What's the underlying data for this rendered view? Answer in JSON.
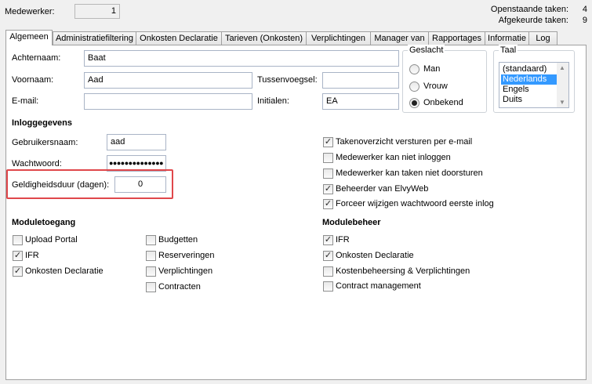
{
  "header": {
    "medewerker_label": "Medewerker:",
    "medewerker_value": "1",
    "openstaande_label": "Openstaande taken:",
    "openstaande_value": "4",
    "afgekeurde_label": "Afgekeurde taken:",
    "afgekeurde_value": "9"
  },
  "tabs": [
    {
      "label": "Algemeen",
      "active": true
    },
    {
      "label": "Administratiefiltering"
    },
    {
      "label": "Onkosten Declaratie"
    },
    {
      "label": "Tarieven (Onkosten)"
    },
    {
      "label": "Verplichtingen"
    },
    {
      "label": "Manager van"
    },
    {
      "label": "Rapportages"
    },
    {
      "label": "Informatie"
    },
    {
      "label": "Log"
    }
  ],
  "form": {
    "achternaam_label": "Achternaam:",
    "achternaam_value": "Baat",
    "voornaam_label": "Voornaam:",
    "voornaam_value": "Aad",
    "tussenvoegsel_label": "Tussenvoegsel:",
    "tussenvoegsel_value": "",
    "email_label": "E-mail:",
    "email_value": "",
    "initialen_label": "Initialen:",
    "initialen_value": "EA"
  },
  "geslacht": {
    "title": "Geslacht",
    "options": [
      "Man",
      "Vrouw",
      "Onbekend"
    ],
    "selected": "Onbekend"
  },
  "taal": {
    "title": "Taal",
    "items": [
      "(standaard)",
      "Nederlands",
      "Engels",
      "Duits"
    ],
    "selected": "Nederlands"
  },
  "inloggegevens": {
    "title": "Inloggegevens",
    "gebruikersnaam_label": "Gebruikersnaam:",
    "gebruikersnaam_value": "aad",
    "wachtwoord_label": "Wachtwoord:",
    "wachtwoord_value": "●●●●●●●●●●●●●●",
    "geldigheidsduur_label": "Geldigheidsduur (dagen):",
    "geldigheidsduur_value": "0"
  },
  "opties": [
    {
      "label": "Takenoverzicht versturen per e-mail",
      "checked": true
    },
    {
      "label": "Medewerker kan niet inloggen",
      "checked": false
    },
    {
      "label": "Medewerker kan taken niet doorsturen",
      "checked": false
    },
    {
      "label": "Beheerder van ElvyWeb",
      "checked": true
    },
    {
      "label": "Forceer wijzigen wachtwoord eerste inlog",
      "checked": true
    }
  ],
  "moduletoegang": {
    "title": "Moduletoegang",
    "col1": [
      {
        "label": "Upload Portal",
        "checked": false
      },
      {
        "label": "IFR",
        "checked": true
      },
      {
        "label": "Onkosten Declaratie",
        "checked": true
      }
    ],
    "col2": [
      {
        "label": "Budgetten",
        "checked": false
      },
      {
        "label": "Reserveringen",
        "checked": false
      },
      {
        "label": "Verplichtingen",
        "checked": false
      },
      {
        "label": "Contracten",
        "checked": false
      }
    ]
  },
  "modulebeheer": {
    "title": "Modulebeheer",
    "items": [
      {
        "label": "IFR",
        "checked": true
      },
      {
        "label": "Onkosten Declaratie",
        "checked": true
      },
      {
        "label": "Kostenbeheersing & Verplichtingen",
        "checked": false
      },
      {
        "label": "Contract management",
        "checked": false
      }
    ]
  },
  "checkmark": "✓"
}
